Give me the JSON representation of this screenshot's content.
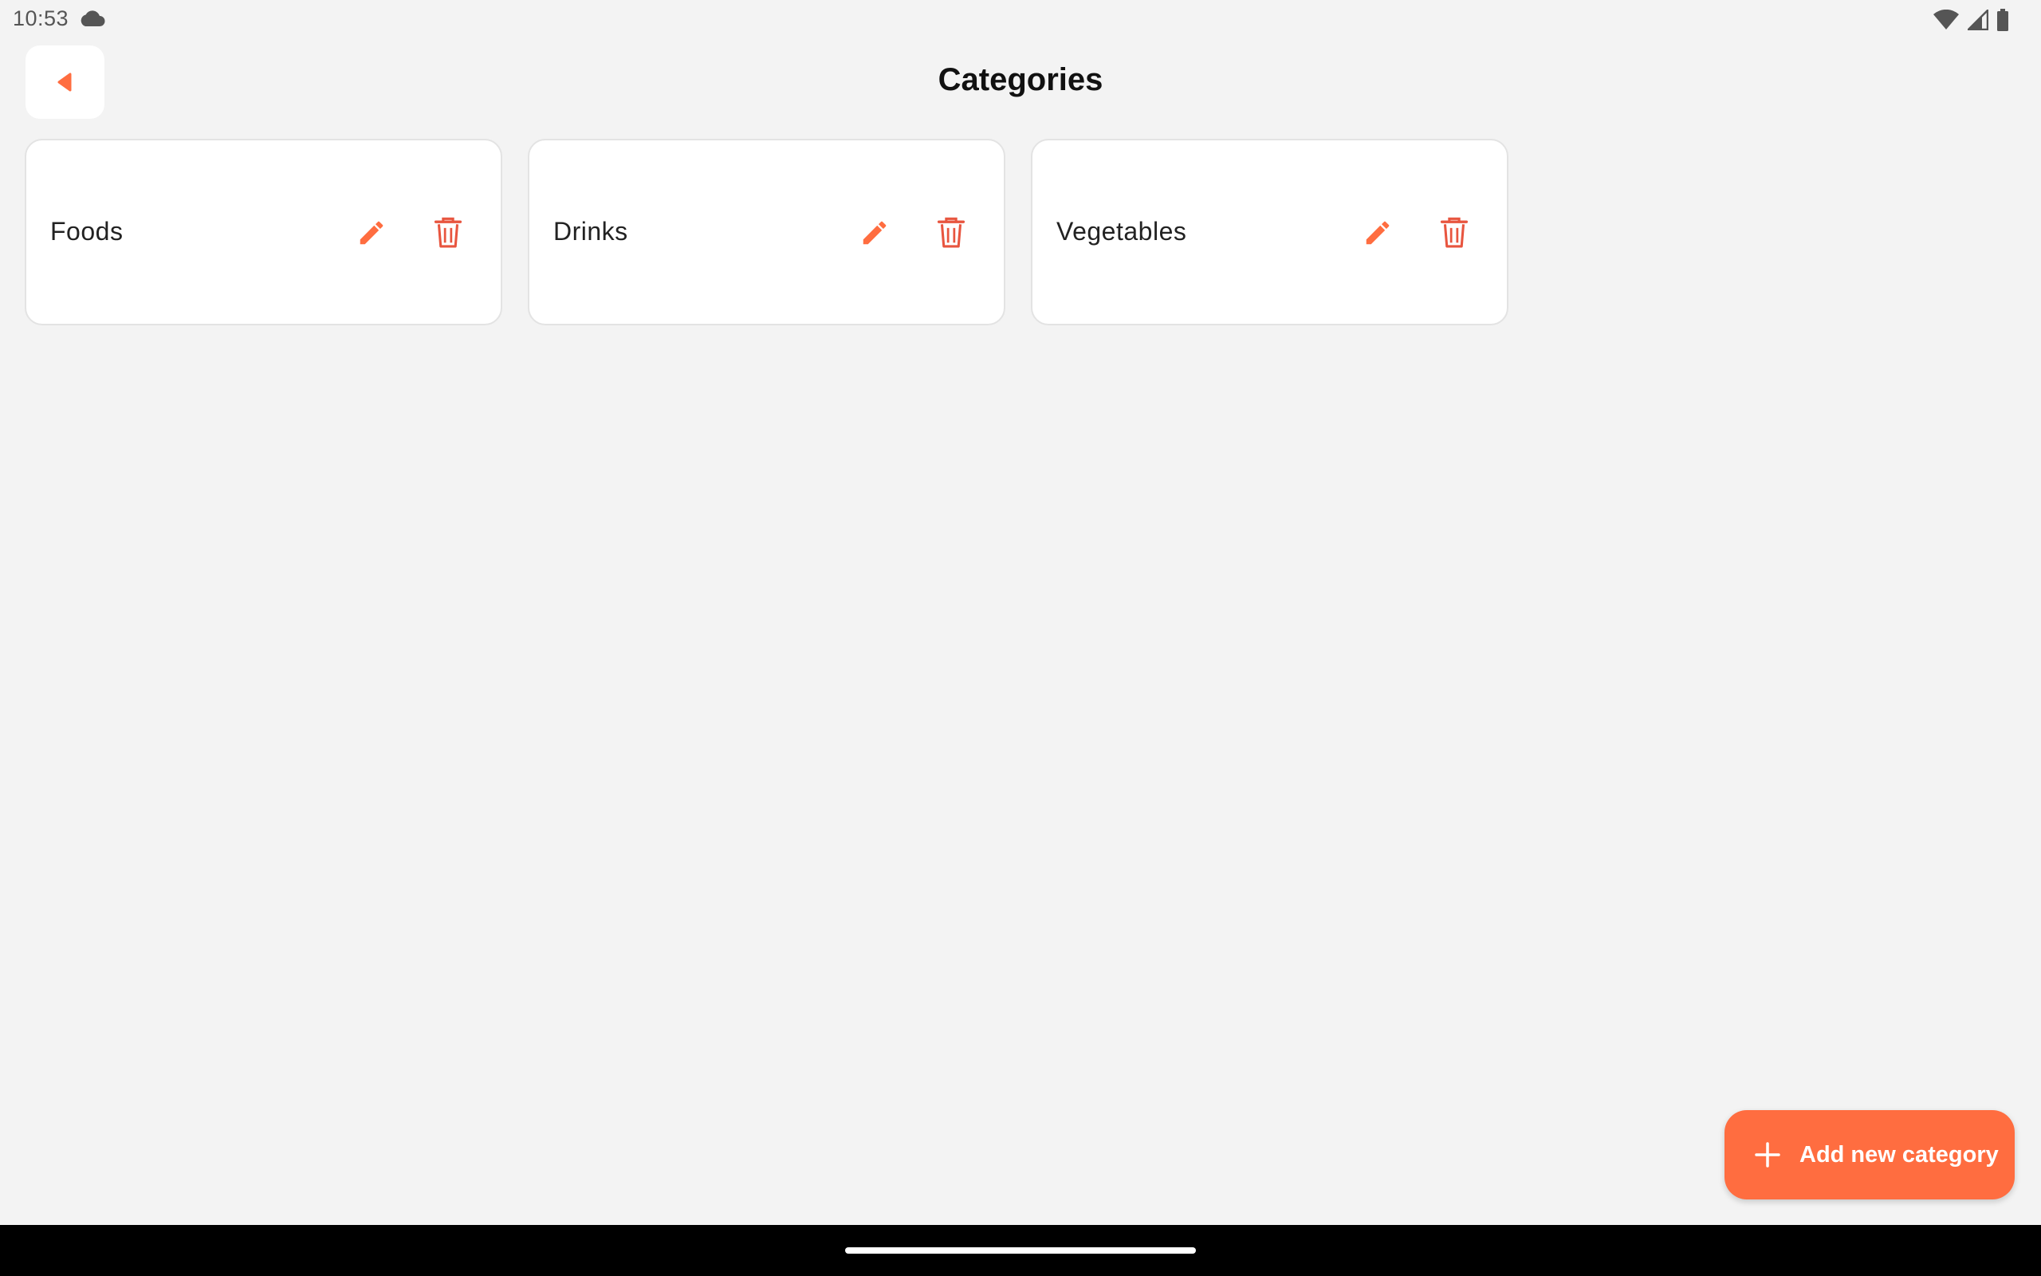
{
  "status_bar": {
    "time": "10:53",
    "icons": [
      "cloud-icon",
      "wifi-icon",
      "signal-icon",
      "battery-icon"
    ]
  },
  "header": {
    "title": "Categories",
    "back_icon": "back-arrow-icon"
  },
  "categories": [
    {
      "label": "Foods"
    },
    {
      "label": "Drinks"
    },
    {
      "label": "Vegetables"
    }
  ],
  "fab": {
    "label": "Add new category",
    "icon": "plus-icon"
  },
  "colors": {
    "accent": "#ff6d40",
    "delete": "#e8553f",
    "background": "#f3f3f3",
    "card": "#ffffff"
  }
}
